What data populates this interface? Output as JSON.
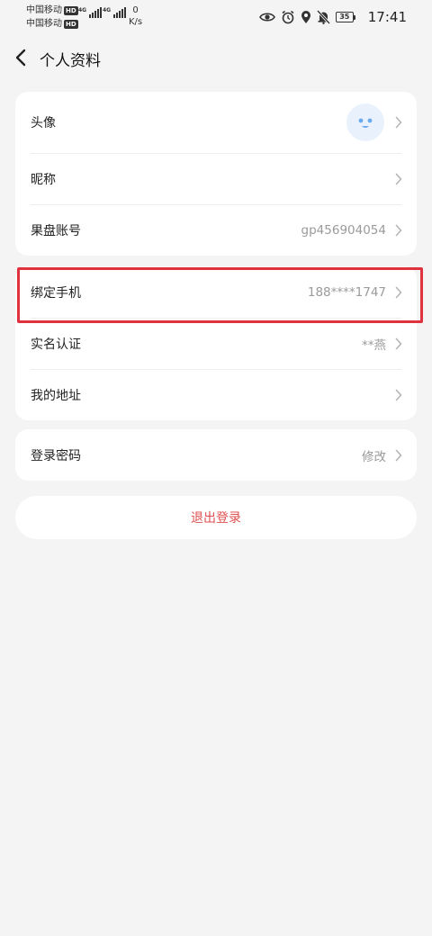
{
  "status_bar": {
    "carrier_1": "中国移动",
    "carrier_2": "中国移动",
    "hd_badge": "HD",
    "network_type": "4G",
    "net_speed_value": "0",
    "net_speed_unit": "K/s",
    "battery_level": "35",
    "time": "17:41",
    "icons": [
      "eye-icon",
      "alarm-icon",
      "location-icon",
      "mute-bell-icon",
      "battery-icon"
    ]
  },
  "header": {
    "title": "个人资料"
  },
  "profile_card": {
    "avatar_label": "头像",
    "nickname_label": "昵称",
    "account_label": "果盘账号",
    "account_value": "gp456904054"
  },
  "binding_card": {
    "phone_label": "绑定手机",
    "phone_value": "188****1747",
    "realname_label": "实名认证",
    "realname_value": "**燕",
    "address_label": "我的地址"
  },
  "password_card": {
    "password_label": "登录密码",
    "password_value": "修改"
  },
  "logout": {
    "label": "退出登录"
  },
  "colors": {
    "page_bg": "#f4f4f5",
    "card_bg": "#ffffff",
    "logout_text": "#e05050",
    "highlight_border": "#e0323e",
    "avatar_bg": "#e9f2fc",
    "avatar_face": "#6aaaf0"
  }
}
